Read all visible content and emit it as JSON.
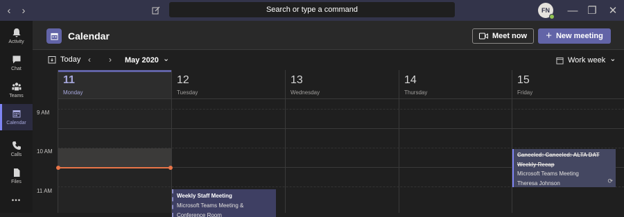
{
  "titlebar": {
    "search_placeholder": "Search or type a command",
    "avatar_initials": "FN",
    "back_glyph": "‹",
    "forward_glyph": "›",
    "minimize_glyph": "—",
    "maximize_glyph": "❐",
    "close_glyph": "✕"
  },
  "rail": {
    "items": [
      {
        "label": "Activity",
        "icon": "bell-icon"
      },
      {
        "label": "Chat",
        "icon": "chat-icon"
      },
      {
        "label": "Teams",
        "icon": "teams-icon"
      },
      {
        "label": "Calendar",
        "icon": "calendar-icon",
        "active": true
      },
      {
        "label": "Calls",
        "icon": "phone-icon"
      },
      {
        "label": "Files",
        "icon": "files-icon"
      }
    ],
    "more_glyph": "•••"
  },
  "header": {
    "title": "Calendar",
    "meet_now_label": "Meet now",
    "new_meeting_label": "New meeting"
  },
  "toolbar": {
    "today_label": "Today",
    "month_label": "May 2020",
    "view_label": "Work week",
    "prev_glyph": "‹",
    "next_glyph": "›",
    "chevron_glyph": "⌄"
  },
  "days": [
    {
      "num": "11",
      "name": "Monday",
      "today": true
    },
    {
      "num": "12",
      "name": "Tuesday"
    },
    {
      "num": "13",
      "name": "Wednesday"
    },
    {
      "num": "14",
      "name": "Thursday"
    },
    {
      "num": "15",
      "name": "Friday"
    }
  ],
  "times": [
    "9 AM",
    "10 AM",
    "11 AM"
  ],
  "events": {
    "staff": {
      "title": "Weekly Staff Meeting",
      "line1": "Microsoft Teams Meeting &",
      "line2": "Conference Room"
    },
    "canceled": {
      "title": "Canceled: Canceled: ALTA DAT",
      "subtitle": "Weekly Recap",
      "line1": "Microsoft Teams Meeting",
      "organizer": "Theresa Johnson",
      "recurring_glyph": "⟳"
    }
  },
  "colors": {
    "titlebar_bg": "#33344a",
    "accent": "#6264a7",
    "now_line": "#e97548",
    "presence": "#92c353"
  }
}
